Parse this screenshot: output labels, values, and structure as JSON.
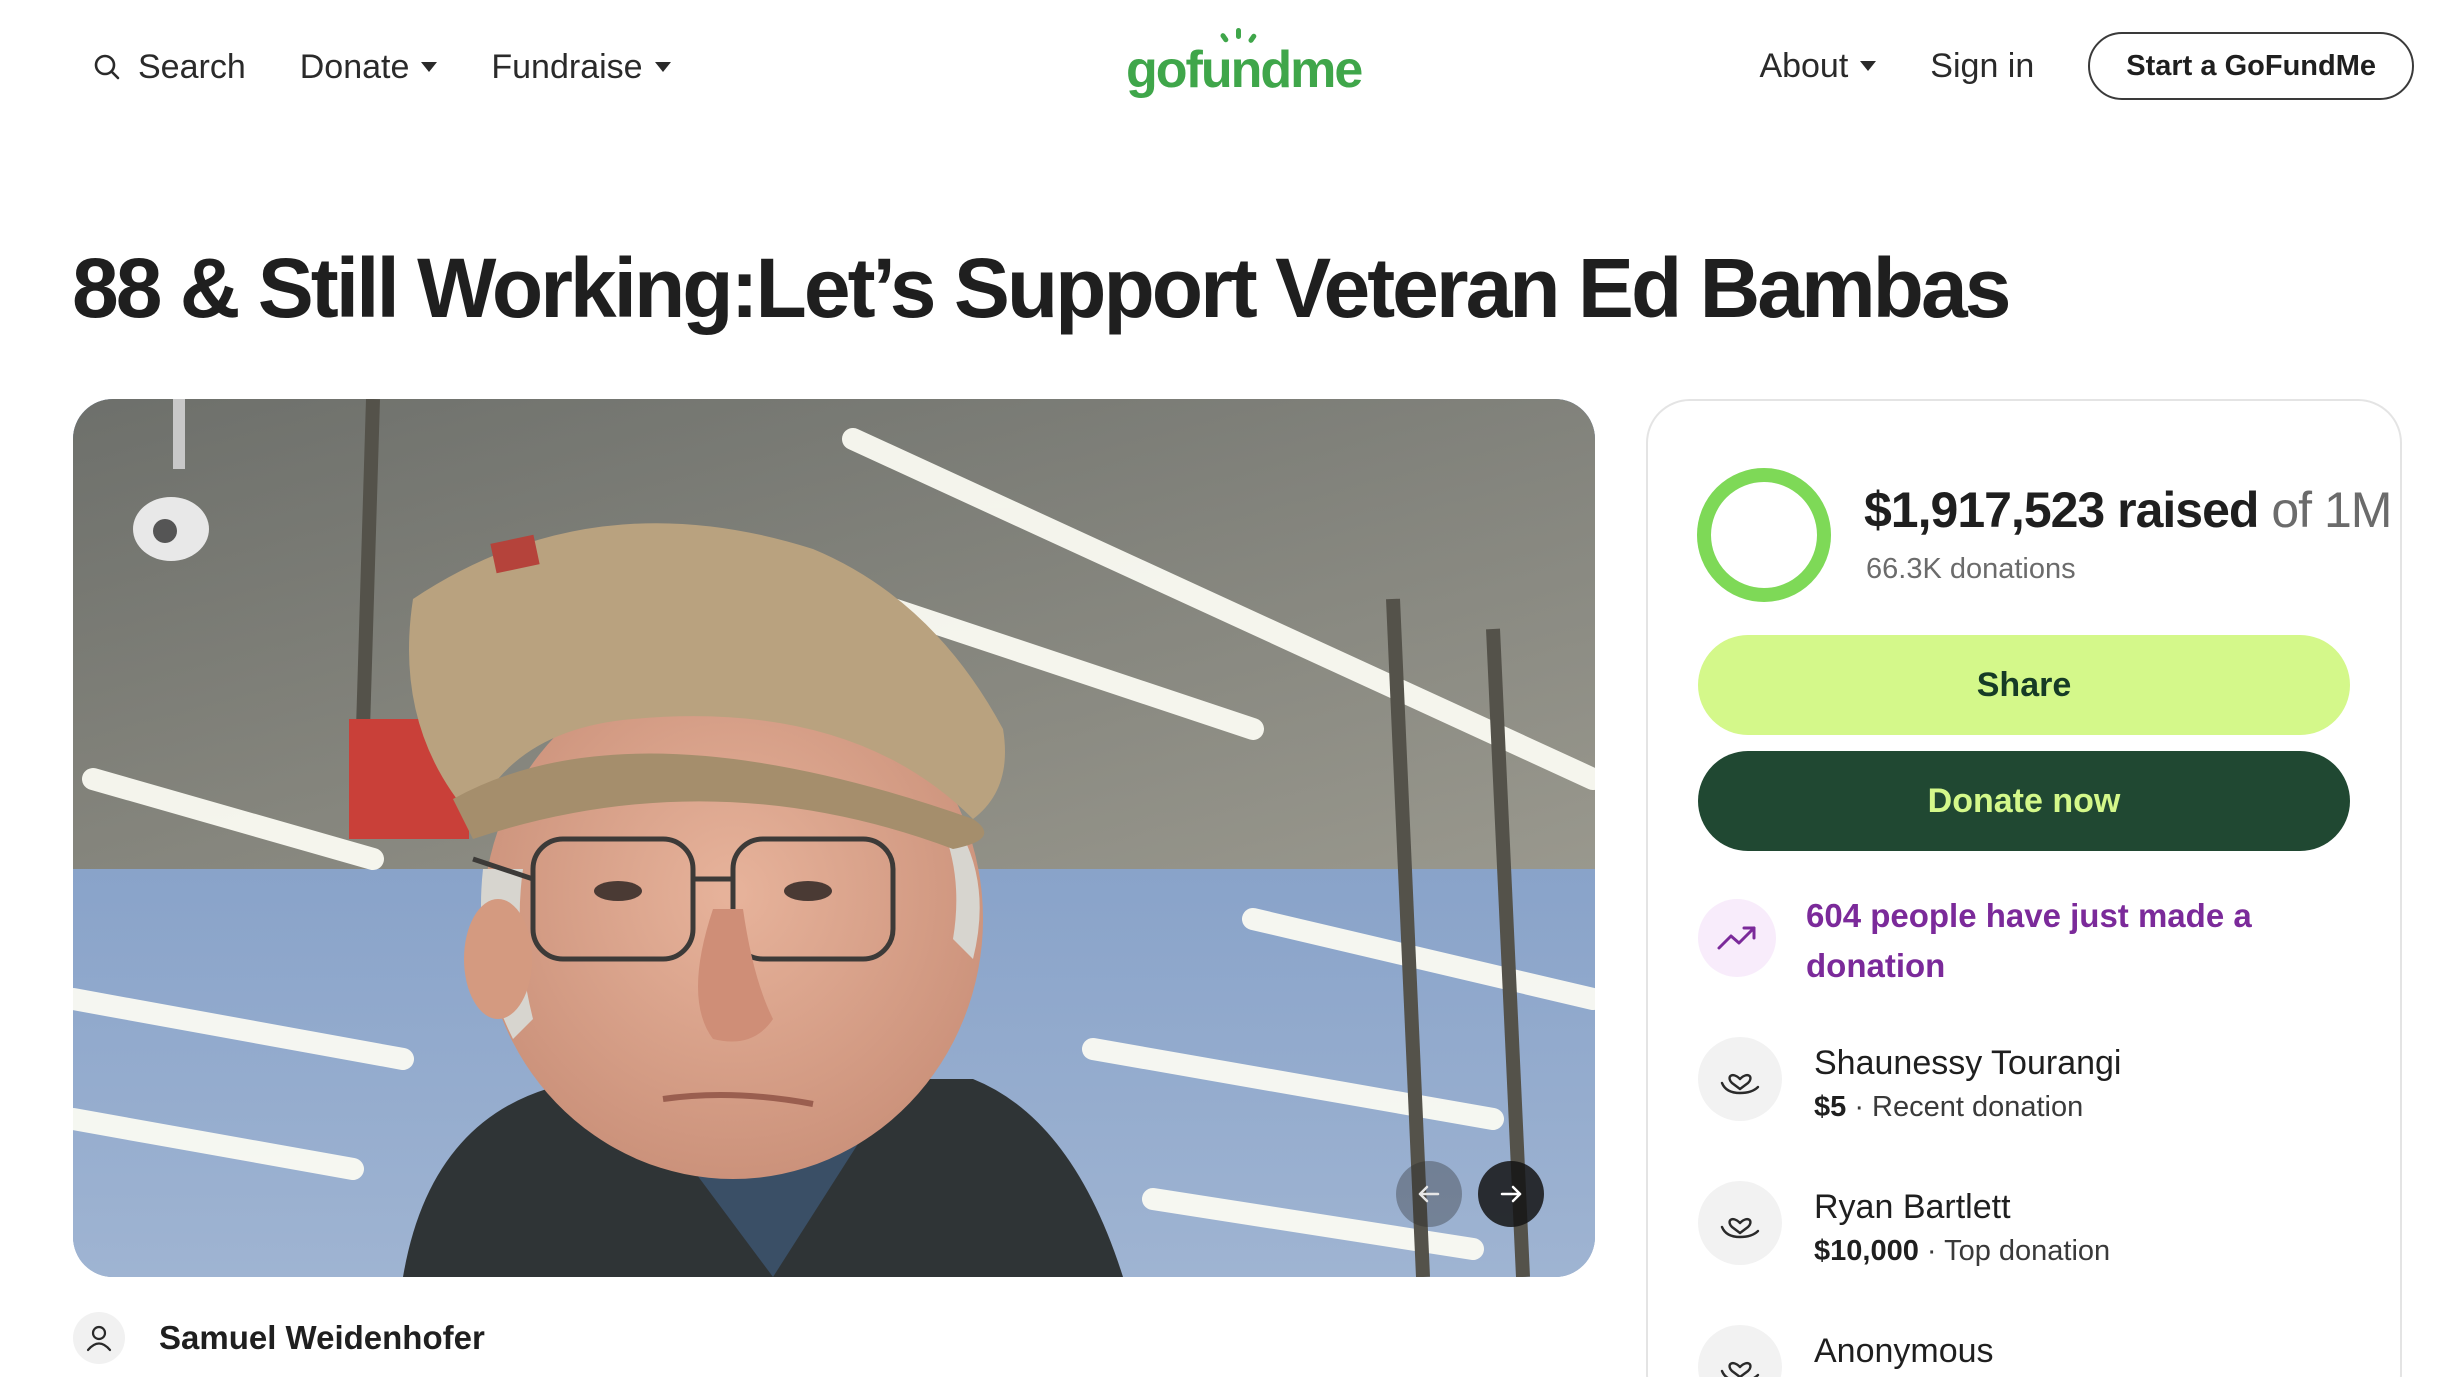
{
  "header": {
    "search_label": "Search",
    "donate_label": "Donate",
    "fundraise_label": "Fundraise",
    "logo_text": "gofundme",
    "about_label": "About",
    "signin_label": "Sign in",
    "start_label": "Start a GoFundMe"
  },
  "campaign": {
    "title": "88 & Still Working:Let’s Support Veteran Ed Bambas",
    "organizer": "Samuel Weidenhofer"
  },
  "hero": {
    "image_icon": "photo-elderly-veteran-in-cap",
    "prev_icon": "arrow-left-icon",
    "next_icon": "arrow-right-icon"
  },
  "donation_card": {
    "raised_amount": "$1,917,523 raised",
    "goal_text": "of 1M",
    "donations_count": "66.3K donations",
    "progress_fraction": 1.0,
    "share_label": "Share",
    "donate_label": "Donate now",
    "trend_text": "604 people have just made a donation",
    "donors": [
      {
        "name": "Shaunessy Tourangi",
        "amount": "$5",
        "note": " · Recent donation"
      },
      {
        "name": "Ryan Bartlett",
        "amount": "$10,000",
        "note": " · Top donation"
      },
      {
        "name": "Anonymous",
        "amount": "",
        "note": ""
      }
    ]
  },
  "colors": {
    "brand_green": "#3fa64a",
    "share_bg": "#d4f88a",
    "donate_bg": "#204832",
    "trend_purple": "#7b2a9a",
    "progress_ring": "#7ed957"
  }
}
